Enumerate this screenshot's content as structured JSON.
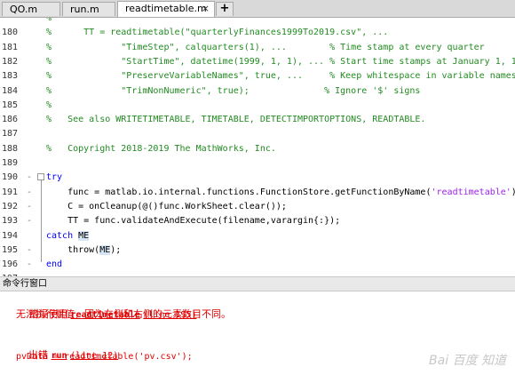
{
  "tabs": [
    {
      "label": "QO.m"
    },
    {
      "label": "run.m"
    },
    {
      "label": "readtimetable.m",
      "close": "×"
    }
  ],
  "add_tab": "+",
  "editor": {
    "lines": [
      {
        "num": "",
        "segs": [
          {
            "t": "%",
            "c": "cm"
          }
        ]
      },
      {
        "num": "180",
        "segs": [
          {
            "t": "%      TT = readtimetable(\"quarterlyFinances1999To2019.csv\", ...",
            "c": "cm"
          }
        ]
      },
      {
        "num": "181",
        "segs": [
          {
            "t": "%             \"TimeStep\", calquarters(1), ...        % Time stamp at every quarter",
            "c": "cm"
          }
        ]
      },
      {
        "num": "182",
        "segs": [
          {
            "t": "%             \"StartTime\", datetime(1999, 1, 1), ... % Start time stamps at January 1, 1999",
            "c": "cm"
          }
        ]
      },
      {
        "num": "183",
        "segs": [
          {
            "t": "%             \"PreserveVariableNames\", true, ...     % Keep whitespace in variable names",
            "c": "cm"
          }
        ]
      },
      {
        "num": "184",
        "segs": [
          {
            "t": "%             \"TrimNonNumeric\", true);              % Ignore '$' signs",
            "c": "cm"
          }
        ]
      },
      {
        "num": "185",
        "segs": [
          {
            "t": "%",
            "c": "cm"
          }
        ]
      },
      {
        "num": "186",
        "segs": [
          {
            "t": "%   See also WRITETIMETABLE, TIMETABLE, DETECTIMPORTOPTIONS, READTABLE.",
            "c": "cm"
          }
        ]
      },
      {
        "num": "187",
        "segs": []
      },
      {
        "num": "188",
        "segs": [
          {
            "t": "%   Copyright 2018-2019 The MathWorks, Inc.",
            "c": "cm"
          }
        ]
      },
      {
        "num": "189",
        "segs": []
      },
      {
        "num": "190",
        "mark": "-",
        "segs": [
          {
            "t": "try",
            "c": "kw"
          }
        ]
      },
      {
        "num": "191",
        "mark": "-",
        "segs": [
          {
            "t": "    func = matlab.io.internal.functions.FunctionStore.getFunctionByName(",
            "c": "nm"
          },
          {
            "t": "'readtimetable'",
            "c": "st"
          },
          {
            "t": ");",
            "c": "nm"
          }
        ]
      },
      {
        "num": "192",
        "mark": "-",
        "segs": [
          {
            "t": "    C = onCleanup(@()func.WorkSheet.clear());",
            "c": "nm"
          }
        ]
      },
      {
        "num": "193",
        "mark": "-",
        "segs": [
          {
            "t": "    TT = func.validateAndExecute(filename,varargin{:});",
            "c": "nm"
          }
        ]
      },
      {
        "num": "194",
        "segs": [
          {
            "t": "catch ",
            "c": "kw"
          },
          {
            "t": "ME",
            "c": "nm hl"
          }
        ]
      },
      {
        "num": "195",
        "mark": "-",
        "segs": [
          {
            "t": "    throw(",
            "c": "nm"
          },
          {
            "t": "ME",
            "c": "nm hl"
          },
          {
            "t": ");",
            "c": "nm"
          }
        ]
      },
      {
        "num": "196",
        "mark": "-",
        "segs": [
          {
            "t": "end",
            "c": "kw"
          }
        ]
      },
      {
        "num": "197",
        "segs": []
      }
    ]
  },
  "command_window": {
    "title": "命令行窗口",
    "error1_prefix": "错误使用 ",
    "error1_func": "readtimetable",
    "error1_line": "(line 195)",
    "error1_msg": "无法执行赋值，因为左侧和右侧的元素数目不同。",
    "error2_prefix": "出错 ",
    "error2_func": "run",
    "error2_line": "(line 12)",
    "command": "pvData = readtimetable('pv.csv');"
  },
  "watermark": "Bai 百度 知道",
  "colors": {
    "comment": "#228b22",
    "keyword": "#0000ff",
    "string": "#a020f0",
    "error": "#e00000"
  }
}
